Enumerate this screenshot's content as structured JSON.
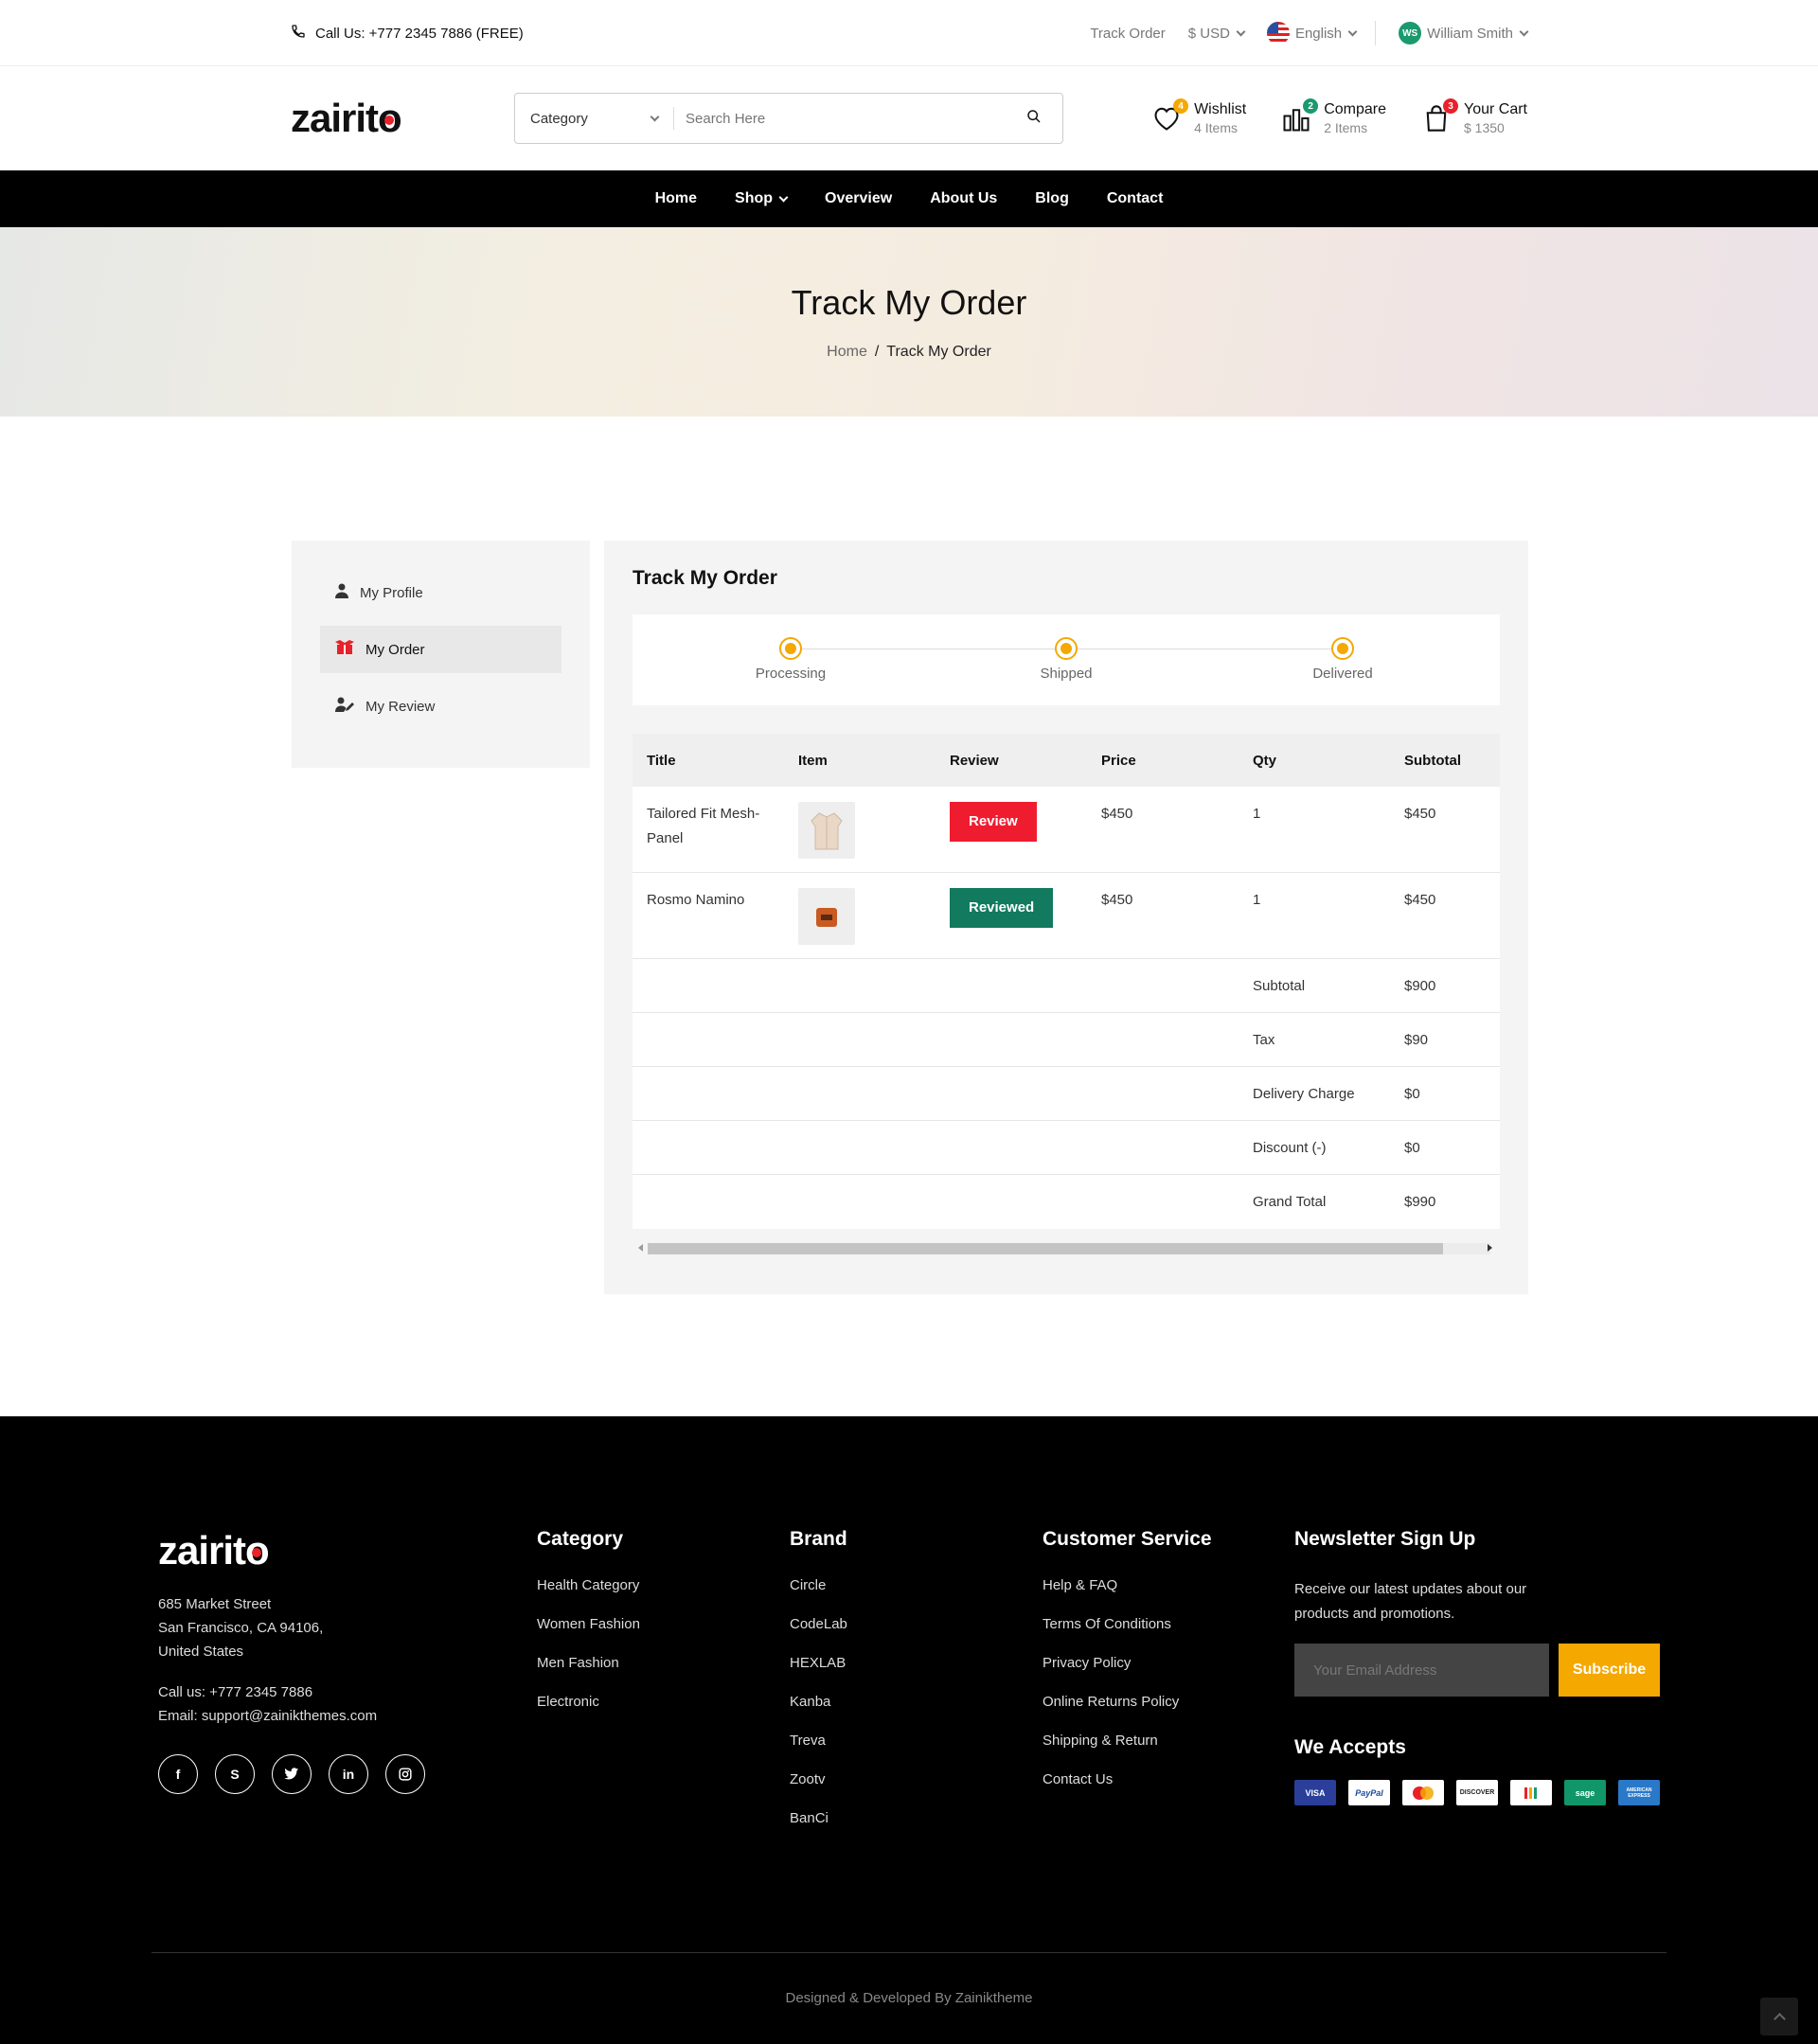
{
  "topbar": {
    "call_label": "Call Us: +777 2345 7886 (FREE)",
    "track_order": "Track Order",
    "currency": "$ USD",
    "language": "English",
    "user_initials": "WS",
    "user_name": "William Smith"
  },
  "header": {
    "logo": "zairito",
    "category_label": "Category",
    "search_placeholder": "Search Here",
    "wishlist": {
      "title": "Wishlist",
      "sub": "4 Items",
      "badge": "4",
      "badge_color": "#f5a800"
    },
    "compare": {
      "title": "Compare",
      "sub": "2 Items",
      "badge": "2",
      "badge_color": "#1a9a6d"
    },
    "cart": {
      "title": "Your Cart",
      "sub": "$ 1350",
      "badge": "3",
      "badge_color": "#e8212a"
    }
  },
  "nav": {
    "items": [
      "Home",
      "Shop",
      "Overview",
      "About Us",
      "Blog",
      "Contact"
    ]
  },
  "banner": {
    "title": "Track My Order",
    "crumb_home": "Home",
    "crumb_sep": "/",
    "crumb_current": "Track My Order"
  },
  "sidebar": {
    "items": [
      "My Profile",
      "My Order",
      "My Review"
    ],
    "active_color": "#e8212a"
  },
  "panel": {
    "title": "Track My Order",
    "steps": [
      "Processing",
      "Shipped",
      "Delivered"
    ],
    "step_color": "#f5a800"
  },
  "table": {
    "headers": [
      "Title",
      "Item",
      "Review",
      "Price",
      "Qty",
      "Subtotal"
    ],
    "rows": [
      {
        "title": "Tailored Fit Mesh-Panel",
        "review": "Review",
        "review_color": "#ef1c2f",
        "price": "$450",
        "qty": "1",
        "subtotal": "$450"
      },
      {
        "title": "Rosmo Namino",
        "review": "Reviewed",
        "review_color": "#127a5e",
        "price": "$450",
        "qty": "1",
        "subtotal": "$450"
      }
    ],
    "summary": [
      {
        "label": "Subtotal",
        "value": "$900"
      },
      {
        "label": "Tax",
        "value": "$90"
      },
      {
        "label": "Delivery Charge",
        "value": "$0"
      },
      {
        "label": "Discount (-)",
        "value": "$0"
      },
      {
        "label": "Grand Total",
        "value": "$990"
      }
    ]
  },
  "footer": {
    "logo": "zairito",
    "address": [
      "685 Market Street",
      "San Francisco, CA 94106,",
      "United States"
    ],
    "phone": "Call us: +777 2345 7886",
    "email": "Email: support@zainikthemes.com",
    "socials": [
      "facebook-icon",
      "skype-icon",
      "twitter-icon",
      "linkedin-icon",
      "instagram-icon"
    ],
    "category": {
      "title": "Category",
      "links": [
        "Health Category",
        "Women Fashion",
        "Men Fashion",
        "Electronic"
      ]
    },
    "brand": {
      "title": "Brand",
      "links": [
        "Circle",
        "CodeLab",
        "HEXLAB",
        "Kanba",
        "Treva",
        "Zootv",
        "BanCi"
      ]
    },
    "service": {
      "title": "Customer Service",
      "links": [
        "Help & FAQ",
        "Terms Of Conditions",
        "Privacy Policy",
        "Online Returns Policy",
        "Shipping & Return",
        "Contact Us"
      ]
    },
    "newsletter": {
      "title": "Newsletter Sign Up",
      "text": "Receive our latest updates about our products and promotions.",
      "placeholder": "Your Email Address",
      "button": "Subscribe",
      "accent": "#f5a800"
    },
    "accepts": {
      "title": "We Accepts",
      "cards": [
        {
          "name": "VISA",
          "bg": "#2a3e9a",
          "fg": "#fff"
        },
        {
          "name": "PayPal",
          "bg": "#fff",
          "fg": "#1a4aa0"
        },
        {
          "name": "mastercard-icon",
          "bg": "#fff",
          "fg": "#e8212a"
        },
        {
          "name": "DISCOVER",
          "bg": "#fff",
          "fg": "#222"
        },
        {
          "name": "google-pay-icon",
          "bg": "#fff",
          "fg": "#f5a800"
        },
        {
          "name": "sage",
          "bg": "#11966a",
          "fg": "#fff"
        },
        {
          "name": "AMERICAN EXPRESS",
          "bg": "#2a78c8",
          "fg": "#fff"
        }
      ]
    },
    "copyright": "Designed & Developed By Zainiktheme"
  }
}
